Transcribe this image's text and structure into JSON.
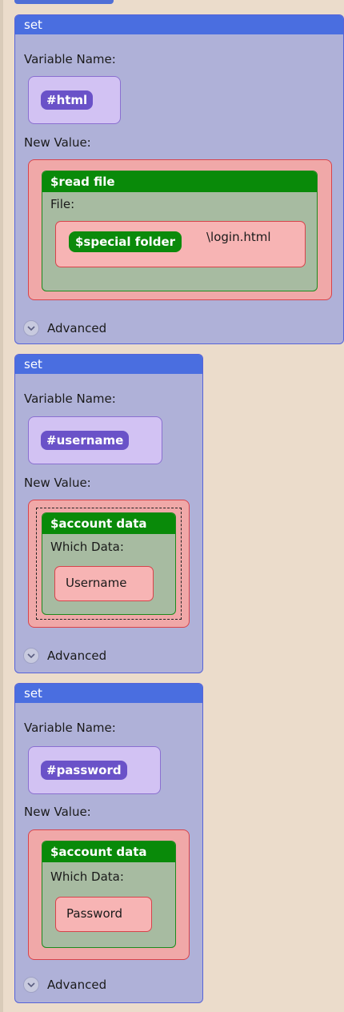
{
  "blocks": [
    {
      "header": "set",
      "variable_label": "Variable Name:",
      "variable": "#html",
      "value_label": "New Value:",
      "value": {
        "function": "$read file",
        "param_label": "File:",
        "param_pill": "$special folder",
        "param_text": "\\login.html"
      },
      "advanced_label": "Advanced"
    },
    {
      "header": "set",
      "variable_label": "Variable Name:",
      "variable": "#username",
      "value_label": "New Value:",
      "value": {
        "function": "$account data",
        "param_label": "Which Data:",
        "param_text": "Username"
      },
      "advanced_label": "Advanced"
    },
    {
      "header": "set",
      "variable_label": "Variable Name:",
      "variable": "#password",
      "value_label": "New Value:",
      "value": {
        "function": "$account data",
        "param_label": "Which Data:",
        "param_text": "Password"
      },
      "advanced_label": "Advanced"
    }
  ],
  "colors": {
    "canvas_background": "#ebdccb",
    "set_header": "#4a6ee0",
    "set_body": "#afb1d8",
    "variable_pill": "#6a52c8",
    "variable_box": "#d2c2f3",
    "value_box": "#f0a8a8",
    "function_header": "#098a09",
    "function_body": "#a7bba1"
  },
  "icons": {
    "advanced_toggle": "chevron-down-icon"
  }
}
